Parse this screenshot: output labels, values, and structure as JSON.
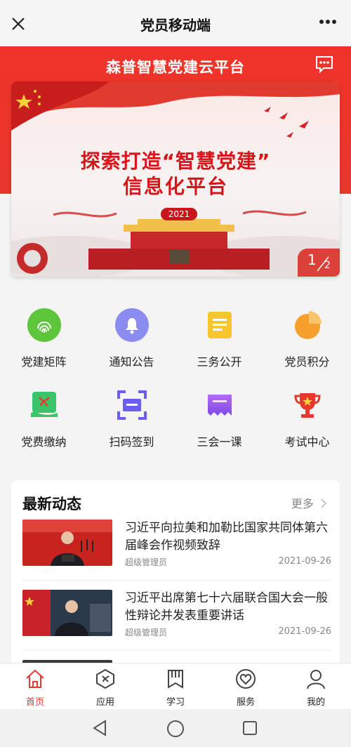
{
  "topbar": {
    "title": "党员移动端",
    "close_icon": "close-icon",
    "more_icon": "more-icon"
  },
  "header": {
    "brand": "森普智慧党建云平台",
    "message_icon": "message-icon"
  },
  "banner": {
    "headline_line1": "探索打造“智慧党建”",
    "headline_line2": "信息化平台",
    "year": "2021",
    "page_current": "1",
    "page_total": "2"
  },
  "shortcuts": [
    {
      "label": "党建矩阵",
      "icon": "fingerprint-icon",
      "color": "#5cc53a"
    },
    {
      "label": "通知公告",
      "icon": "bell-icon",
      "color": "#8a8cf0"
    },
    {
      "label": "三务公开",
      "icon": "document-icon",
      "color": "#f7c52c"
    },
    {
      "label": "党员积分",
      "icon": "pie-chart-icon",
      "color": "#f5a02a"
    },
    {
      "label": "党费缴纳",
      "icon": "party-emblem-icon",
      "color": "#3cc46a"
    },
    {
      "label": "扫码签到",
      "icon": "scan-icon",
      "color": "#6a5df0"
    },
    {
      "label": "三会一课",
      "icon": "banner-icon",
      "color": "#9b5df0"
    },
    {
      "label": "考试中心",
      "icon": "trophy-icon",
      "color": "#e8372c"
    }
  ],
  "news": {
    "heading": "最新动态",
    "more_label": "更多",
    "items": [
      {
        "title": "习近平向拉美和加勒比国家共同体第六届峰会作视频致辞",
        "author": "超级管理员",
        "date": "2021-09-26"
      },
      {
        "title": "习近平出席第七十六届联合国大会一般性辩论并发表重要讲话",
        "author": "超级管理员",
        "date": "2021-09-26"
      }
    ]
  },
  "tabbar": [
    {
      "label": "首页",
      "icon": "home-icon"
    },
    {
      "label": "应用",
      "icon": "apps-icon"
    },
    {
      "label": "学习",
      "icon": "book-icon"
    },
    {
      "label": "服务",
      "icon": "heart-icon"
    },
    {
      "label": "我的",
      "icon": "user-icon"
    }
  ],
  "colors": {
    "accent": "#e8372c",
    "tab_active": "#e23b32"
  }
}
